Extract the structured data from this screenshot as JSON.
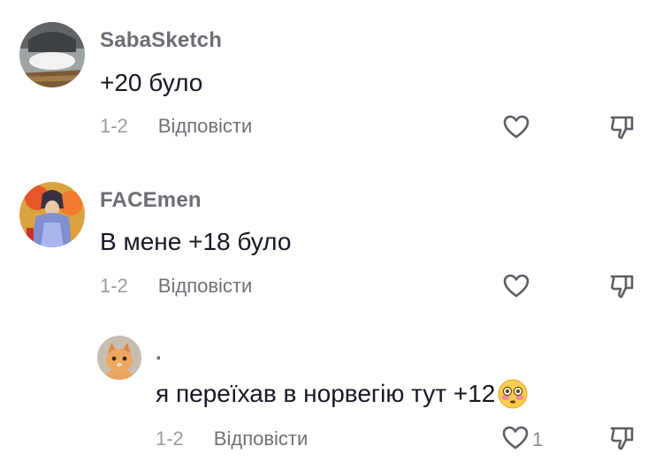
{
  "comments": [
    {
      "username": "SabaSketch",
      "text": "+20 було",
      "date": "1-2",
      "reply_label": "Відповісти",
      "like_count": ""
    },
    {
      "username": "FACEmen",
      "text": "В мене +18 було",
      "date": "1-2",
      "reply_label": "Відповісти",
      "like_count": ""
    },
    {
      "username": ".",
      "text": "я переїхав в норвегію тут +12",
      "emoji": "flushed-face",
      "date": "1-2",
      "reply_label": "Відповісти",
      "like_count": "1"
    }
  ],
  "colors": {
    "username": "#6b6e75",
    "text": "#161823",
    "meta": "#8a8b91",
    "icon": "#5d5f66"
  }
}
